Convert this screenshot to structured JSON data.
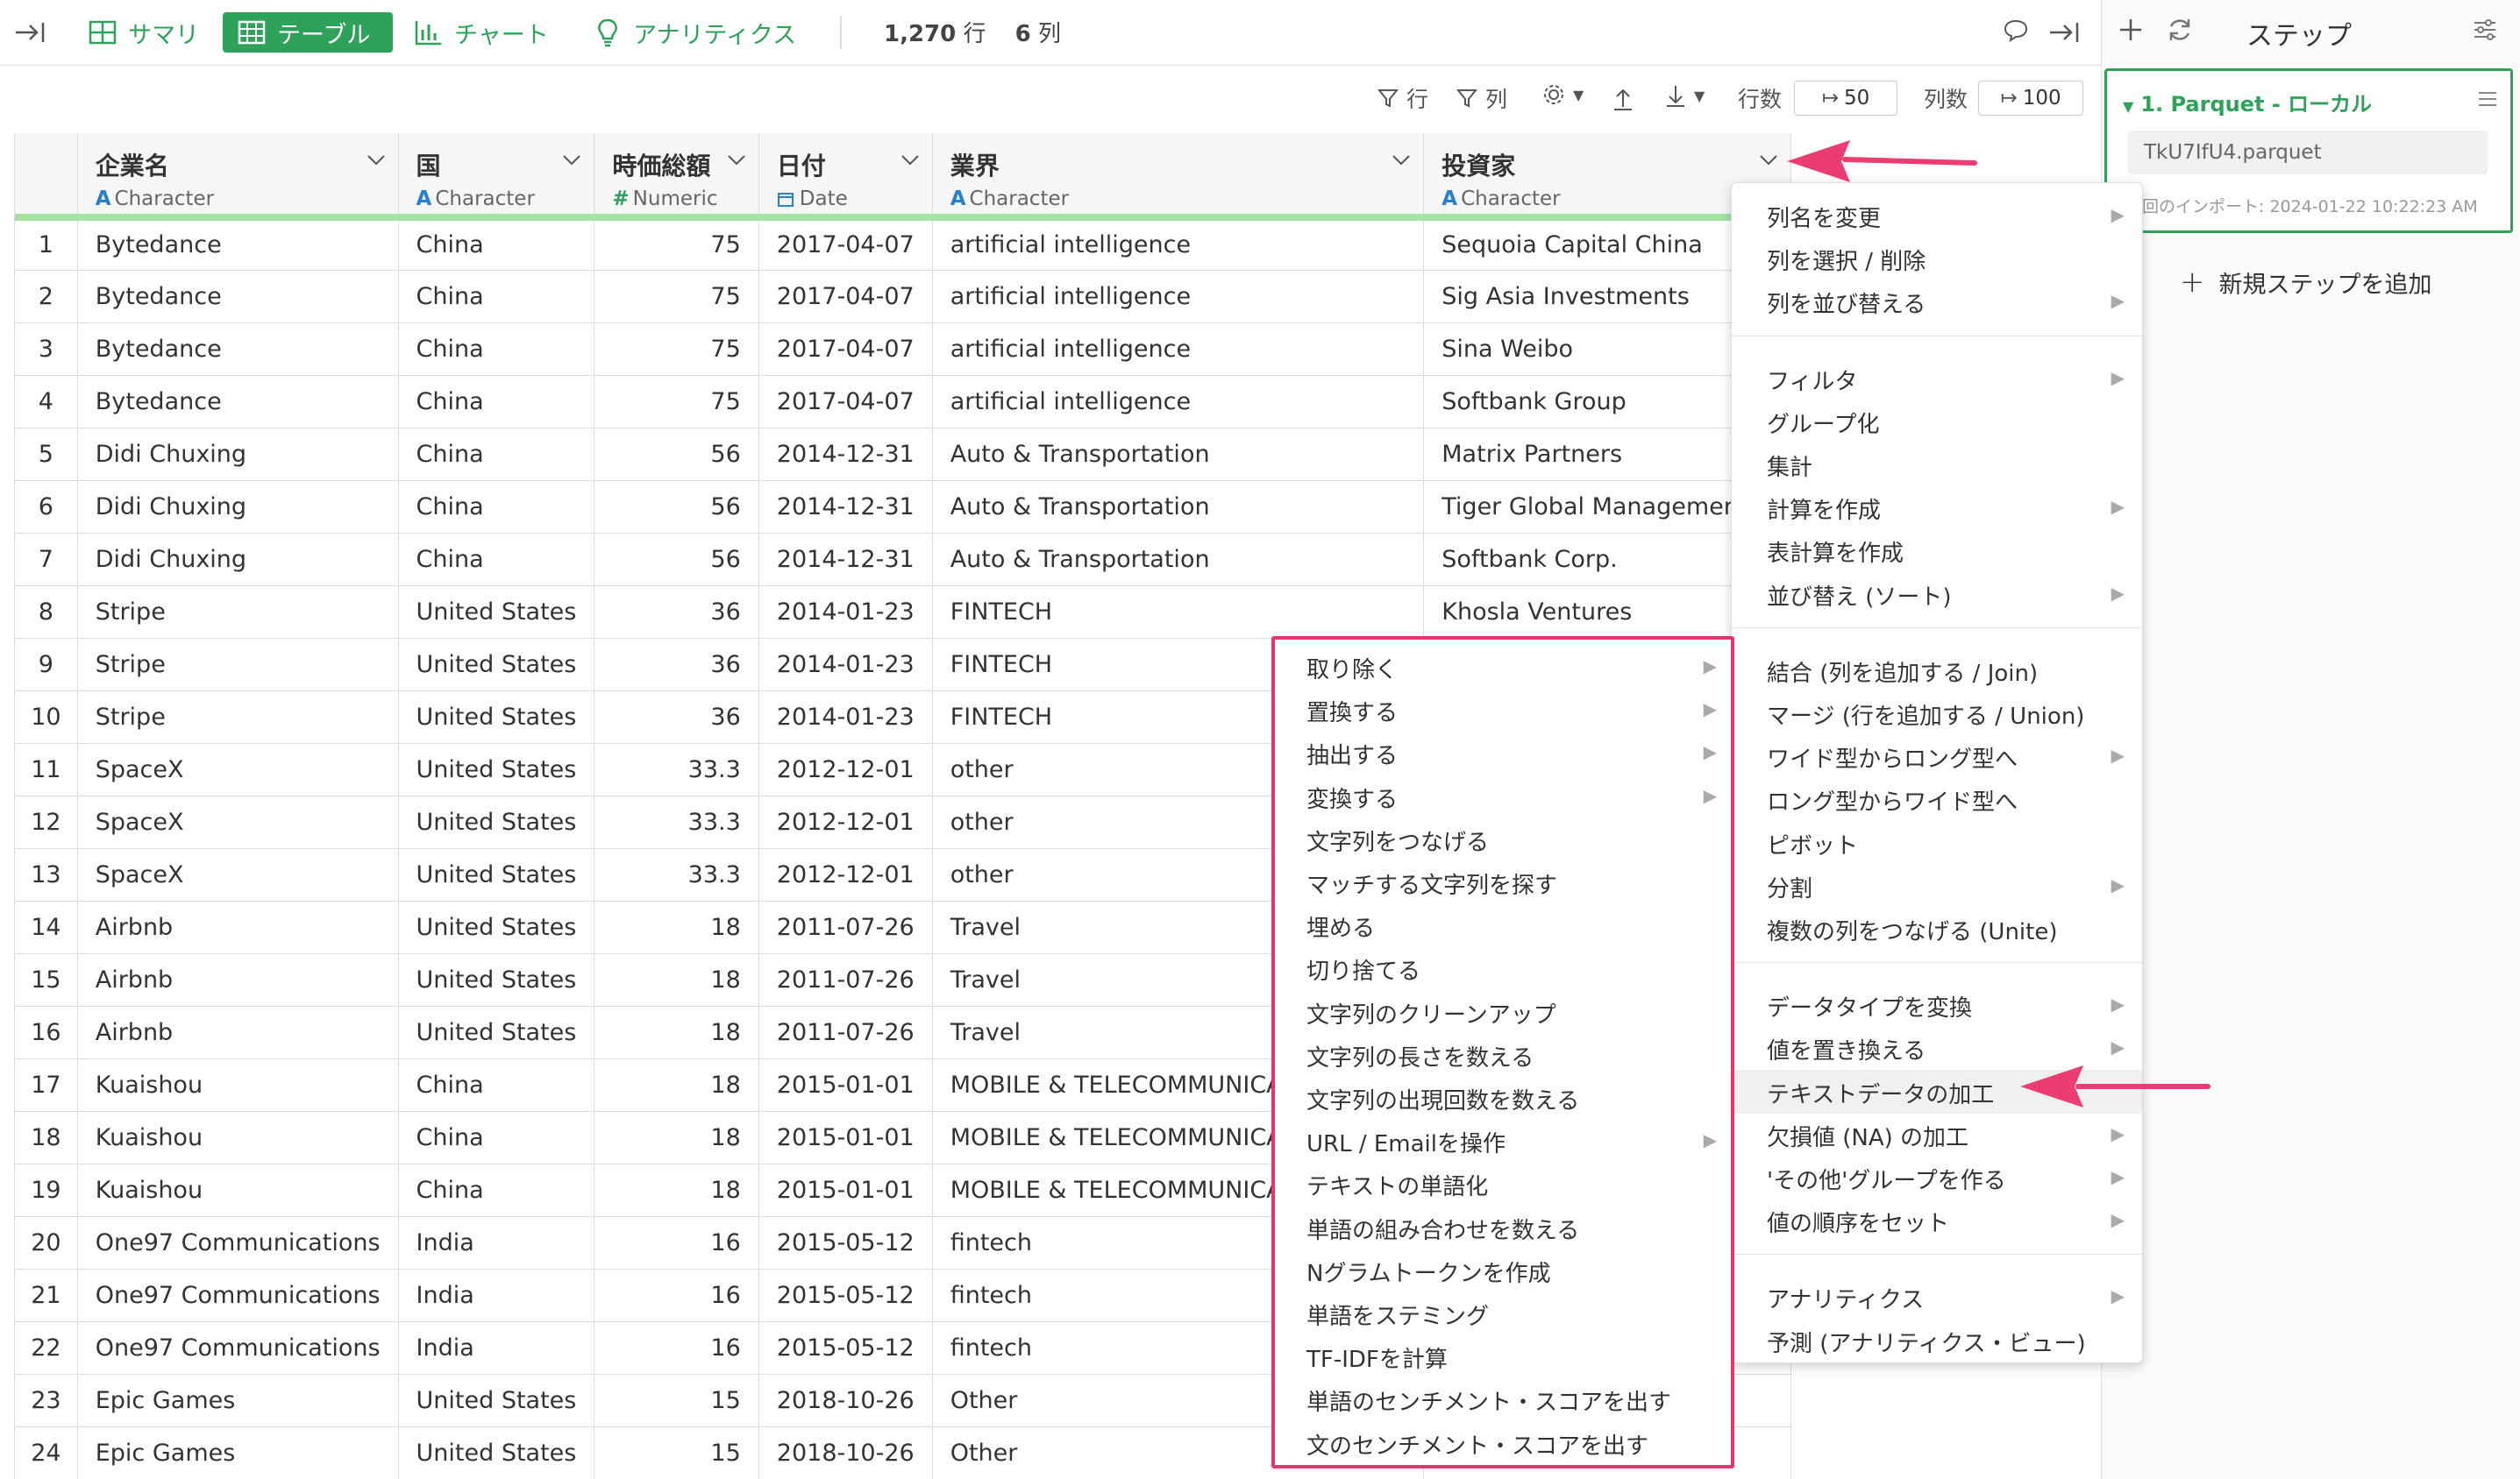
{
  "toolbar": {
    "tabs": [
      {
        "label": "サマリ",
        "icon": "summary-grid-icon"
      },
      {
        "label": "テーブル",
        "icon": "table-icon",
        "active": true
      },
      {
        "label": "チャート",
        "icon": "bar-chart-icon"
      },
      {
        "label": "アナリティクス",
        "icon": "lightbulb-icon"
      }
    ],
    "rows_count": "1,270",
    "rows_unit": "行",
    "cols_count": "6",
    "cols_unit": "列"
  },
  "subtoolbar": {
    "row_filter": "行",
    "col_filter": "列",
    "rows_label": "行数",
    "rows_value": "50",
    "cols_label": "列数",
    "cols_value": "100"
  },
  "table": {
    "columns": [
      {
        "name": "企業名",
        "type": "Character",
        "type_icon": "A"
      },
      {
        "name": "国",
        "type": "Character",
        "type_icon": "A"
      },
      {
        "name": "時価総額",
        "type": "Numeric",
        "type_icon": "#"
      },
      {
        "name": "日付",
        "type": "Date",
        "type_icon": "calendar-icon"
      },
      {
        "name": "業界",
        "type": "Character",
        "type_icon": "A"
      },
      {
        "name": "投資家",
        "type": "Character",
        "type_icon": "A"
      }
    ],
    "rows": [
      [
        "1",
        "Bytedance",
        "China",
        "75",
        "2017-04-07",
        "artificial intelligence",
        "Sequoia Capital China"
      ],
      [
        "2",
        "Bytedance",
        "China",
        "75",
        "2017-04-07",
        "artificial intelligence",
        "Sig Asia Investments"
      ],
      [
        "3",
        "Bytedance",
        "China",
        "75",
        "2017-04-07",
        "artificial intelligence",
        "Sina Weibo"
      ],
      [
        "4",
        "Bytedance",
        "China",
        "75",
        "2017-04-07",
        "artificial intelligence",
        "Softbank Group"
      ],
      [
        "5",
        "Didi Chuxing",
        "China",
        "56",
        "2014-12-31",
        "Auto & Transportation",
        "Matrix Partners"
      ],
      [
        "6",
        "Didi Chuxing",
        "China",
        "56",
        "2014-12-31",
        "Auto & Transportation",
        "Tiger   Global Management"
      ],
      [
        "7",
        "Didi Chuxing",
        "China",
        "56",
        "2014-12-31",
        "Auto & Transportation",
        "Softbank Corp."
      ],
      [
        "8",
        "Stripe",
        "United States",
        "36",
        "2014-01-23",
        "FINTECH",
        "Khosla Ventures"
      ],
      [
        "9",
        "Stripe",
        "United States",
        "36",
        "2014-01-23",
        "FINTECH",
        ""
      ],
      [
        "10",
        "Stripe",
        "United States",
        "36",
        "2014-01-23",
        "FINTECH",
        ""
      ],
      [
        "11",
        "SpaceX",
        "United States",
        "33.3",
        "2012-12-01",
        "other",
        ""
      ],
      [
        "12",
        "SpaceX",
        "United States",
        "33.3",
        "2012-12-01",
        "other",
        ""
      ],
      [
        "13",
        "SpaceX",
        "United States",
        "33.3",
        "2012-12-01",
        "other",
        ""
      ],
      [
        "14",
        "Airbnb",
        "United States",
        "18",
        "2011-07-26",
        "Travel",
        ""
      ],
      [
        "15",
        "Airbnb",
        "United States",
        "18",
        "2011-07-26",
        "Travel",
        ""
      ],
      [
        "16",
        "Airbnb",
        "United States",
        "18",
        "2011-07-26",
        "Travel",
        ""
      ],
      [
        "17",
        "Kuaishou",
        "China",
        "18",
        "2015-01-01",
        "MOBILE & TELECOMMUNICAT",
        ""
      ],
      [
        "18",
        "Kuaishou",
        "China",
        "18",
        "2015-01-01",
        "MOBILE & TELECOMMUNICAT",
        ""
      ],
      [
        "19",
        "Kuaishou",
        "China",
        "18",
        "2015-01-01",
        "MOBILE & TELECOMMUNICAT",
        ""
      ],
      [
        "20",
        "One97 Communications",
        "India",
        "16",
        "2015-05-12",
        "fintech",
        ""
      ],
      [
        "21",
        "One97 Communications",
        "India",
        "16",
        "2015-05-12",
        "fintech",
        ""
      ],
      [
        "22",
        "One97 Communications",
        "India",
        "16",
        "2015-05-12",
        "fintech",
        ""
      ],
      [
        "23",
        "Epic Games",
        "United States",
        "15",
        "2018-10-26",
        "Other",
        ""
      ],
      [
        "24",
        "Epic Games",
        "United States",
        "15",
        "2018-10-26",
        "Other",
        ""
      ]
    ]
  },
  "column_menu": {
    "groups": [
      [
        {
          "label": "列名を変更",
          "sub": true
        },
        {
          "label": "列を選択 / 削除",
          "sub": false
        },
        {
          "label": "列を並び替える",
          "sub": true
        }
      ],
      [
        {
          "label": "フィルタ",
          "sub": true
        },
        {
          "label": "グループ化",
          "sub": false
        },
        {
          "label": "集計",
          "sub": false
        },
        {
          "label": "計算を作成",
          "sub": true
        },
        {
          "label": "表計算を作成",
          "sub": false
        },
        {
          "label": "並び替え (ソート)",
          "sub": true
        }
      ],
      [
        {
          "label": "結合 (列を追加する / Join)",
          "sub": false
        },
        {
          "label": "マージ (行を追加する / Union)",
          "sub": false
        },
        {
          "label": "ワイド型からロング型へ",
          "sub": true
        },
        {
          "label": "ロング型からワイド型へ",
          "sub": false
        },
        {
          "label": "ピボット",
          "sub": false
        },
        {
          "label": "分割",
          "sub": true
        },
        {
          "label": "複数の列をつなげる (Unite)",
          "sub": false
        }
      ],
      [
        {
          "label": "データタイプを変換",
          "sub": true
        },
        {
          "label": "値を置き換える",
          "sub": true
        },
        {
          "label": "テキストデータの加工",
          "sub": false,
          "highlighted": true
        },
        {
          "label": "欠損値 (NA) の加工",
          "sub": true
        },
        {
          "label": "'その他'グループを作る",
          "sub": true
        },
        {
          "label": "値の順序をセット",
          "sub": true
        }
      ],
      [
        {
          "label": "アナリティクス",
          "sub": true
        },
        {
          "label": "予測 (アナリティクス・ビュー)",
          "sub": false
        }
      ]
    ]
  },
  "text_submenu": {
    "items": [
      {
        "label": "取り除く",
        "sub": true
      },
      {
        "label": "置換する",
        "sub": true
      },
      {
        "label": "抽出する",
        "sub": true
      },
      {
        "label": "変換する",
        "sub": true
      },
      {
        "label": "文字列をつなげる",
        "sub": false
      },
      {
        "label": "マッチする文字列を探す",
        "sub": false
      },
      {
        "label": "埋める",
        "sub": false
      },
      {
        "label": "切り捨てる",
        "sub": false
      },
      {
        "label": "文字列のクリーンアップ",
        "sub": false
      },
      {
        "label": "文字列の長さを数える",
        "sub": false
      },
      {
        "label": "文字列の出現回数を数える",
        "sub": false
      },
      {
        "label": "URL / Emailを操作",
        "sub": true
      },
      {
        "label": "テキストの単語化",
        "sub": false
      },
      {
        "label": "単語の組み合わせを数える",
        "sub": false
      },
      {
        "label": "Nグラムトークンを作成",
        "sub": false
      },
      {
        "label": "単語をステミング",
        "sub": false
      },
      {
        "label": "TF-IDFを計算",
        "sub": false
      },
      {
        "label": "単語のセンチメント・スコアを出す",
        "sub": false
      },
      {
        "label": "文のセンチメント・スコアを出す",
        "sub": false
      }
    ]
  },
  "steps_panel": {
    "title": "ステップ",
    "step_title": "1. Parquet - ローカル",
    "file_name": "TkU7IfU4.parquet",
    "import_info": "回のインポート: 2024-01-22 10:22:23 AM",
    "add_step": "新規ステップを追加"
  },
  "colors": {
    "brand": "#2ea25a",
    "highlight": "#e8336f",
    "header_bar": "#a6e3a1"
  }
}
